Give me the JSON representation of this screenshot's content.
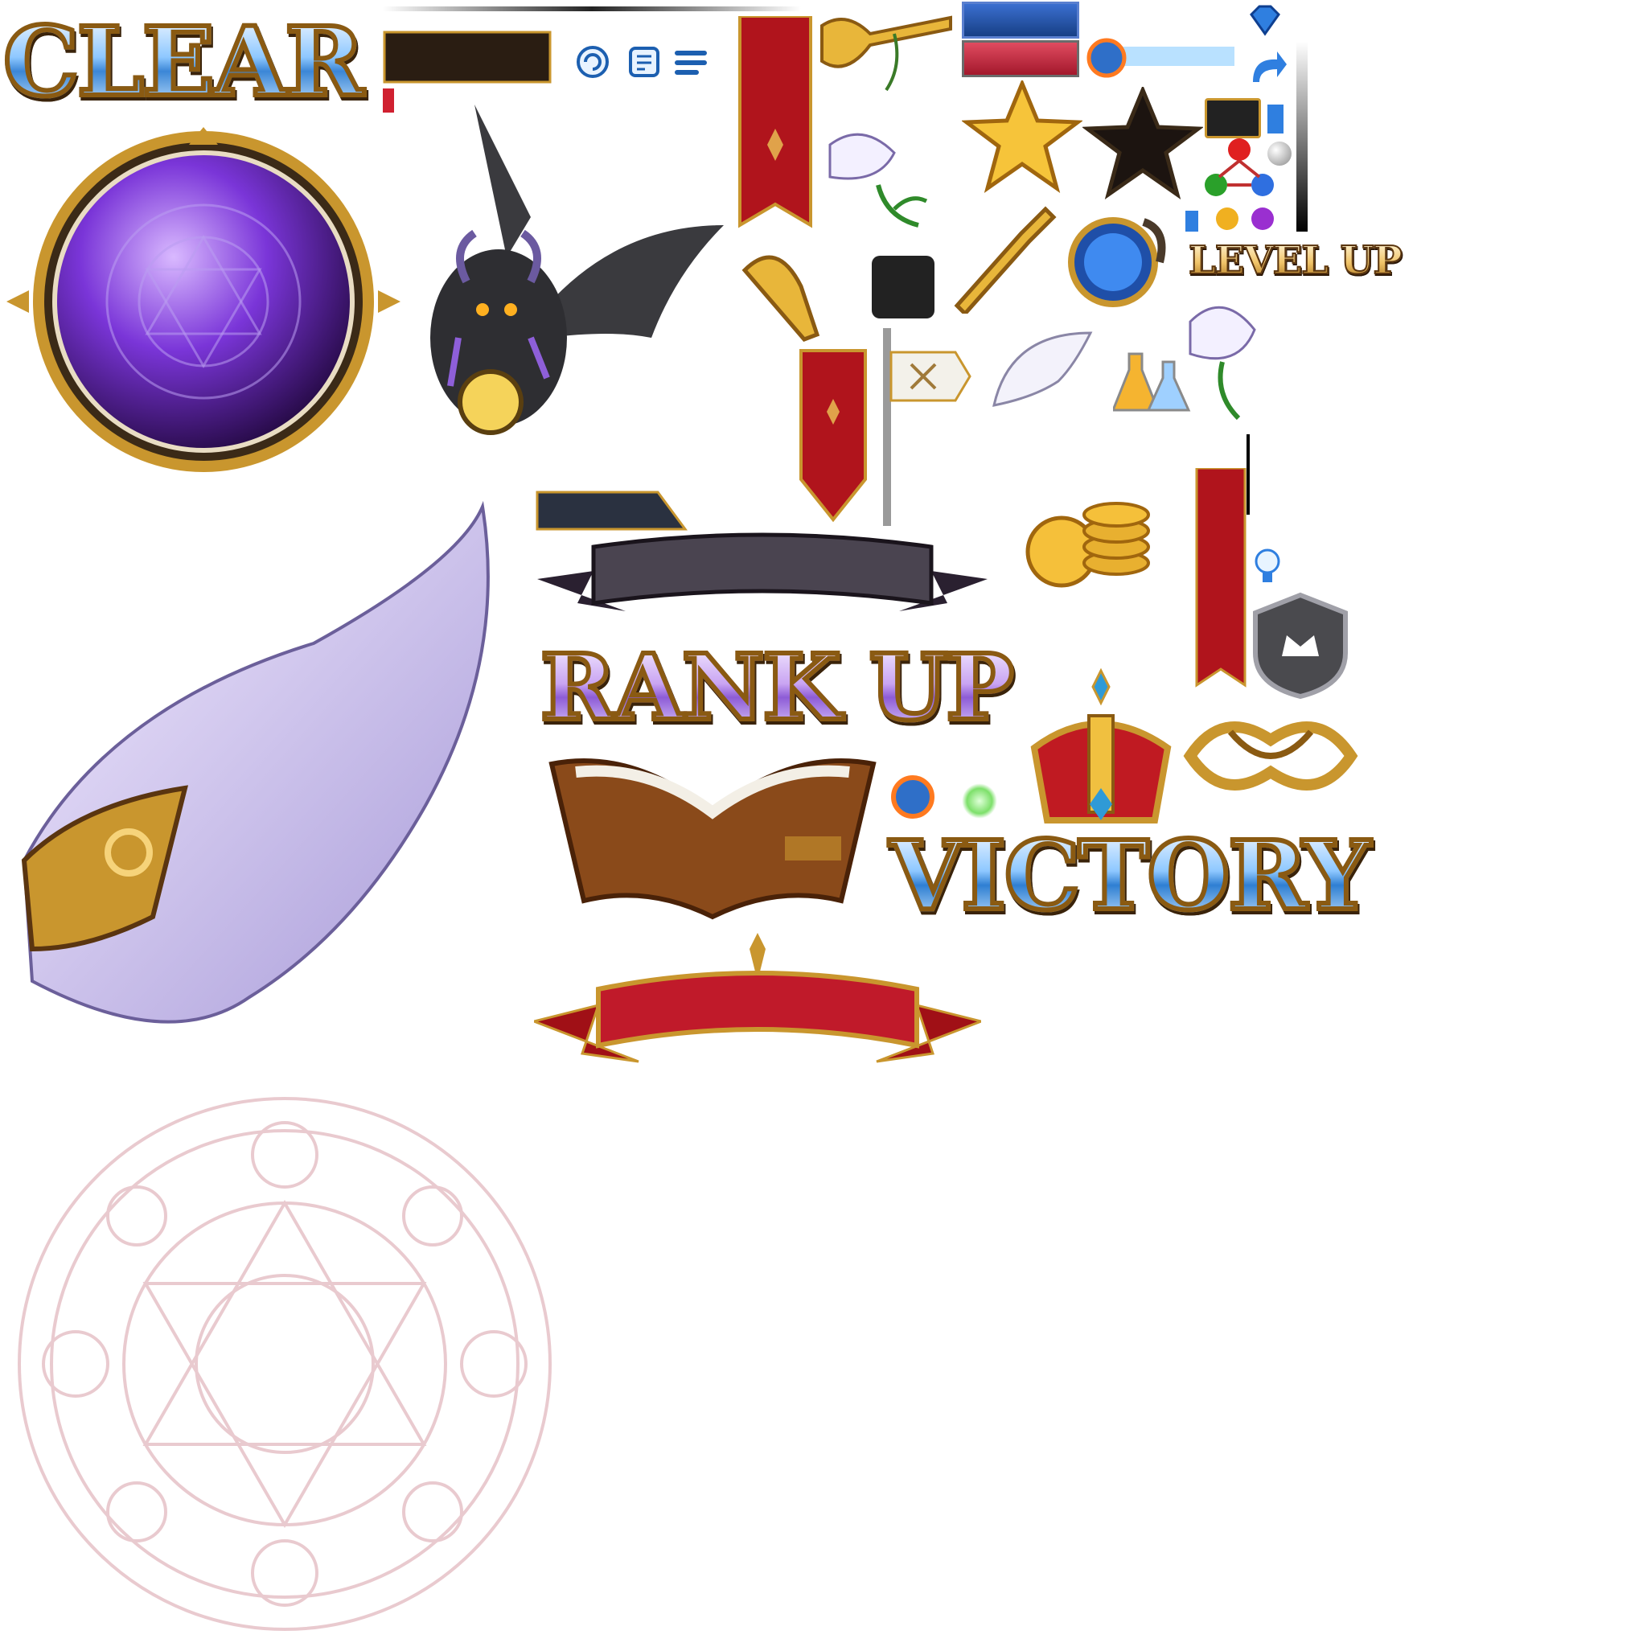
{
  "sheet": {
    "titles": {
      "clear": "CLEAR",
      "rank_up": "RANK UP",
      "victory": "VICTORY",
      "level_up": "LEVEL UP"
    },
    "icons": [
      "purple-orb-frame-icon",
      "demon-dragon-icon",
      "angel-wing-icon",
      "magic-circle-icon",
      "trumpet-icon",
      "lily-icon",
      "star-gold-icon",
      "star-dark-icon",
      "red-banner-icon",
      "open-book-icon",
      "crown-icon",
      "gold-coins-icon",
      "shield-crown-icon",
      "gem-icon",
      "potion-icon",
      "ribbon-icon"
    ],
    "colors": {
      "gold": "#c9962e",
      "banner_red": "#b0141c",
      "purple": "#6a2fc9",
      "blue": "#2f7fd2"
    }
  }
}
